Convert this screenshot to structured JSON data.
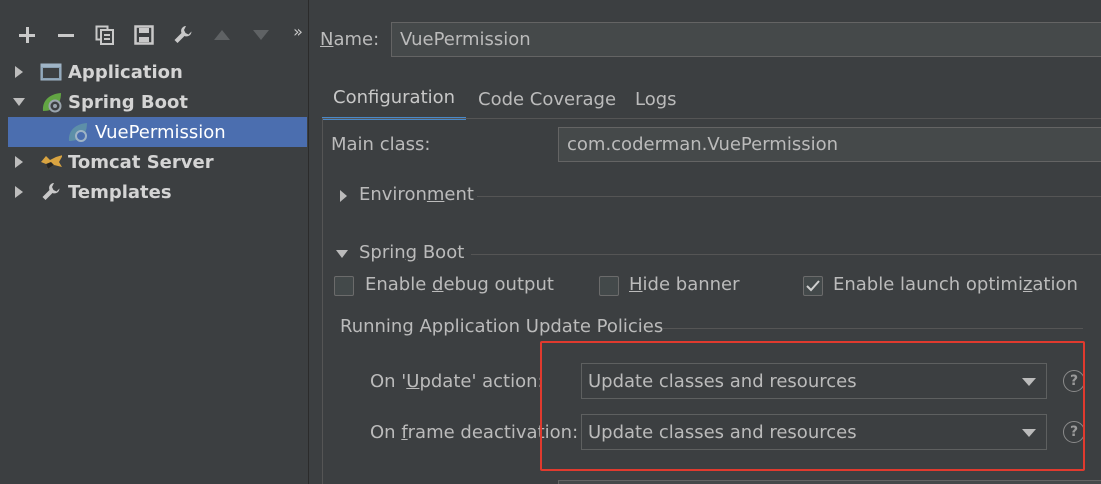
{
  "toolbar": {
    "items": [
      {
        "icon": "add-icon"
      },
      {
        "icon": "remove-icon"
      },
      {
        "icon": "copy-icon"
      },
      {
        "icon": "save-icon"
      },
      {
        "icon": "wrench-icon"
      },
      {
        "icon": "move-up-icon"
      },
      {
        "icon": "move-down-icon"
      },
      {
        "icon": "more-chevron-icon",
        "glyph": "»"
      }
    ]
  },
  "tree": {
    "items": [
      {
        "label": "Application",
        "expanded": false,
        "icon": "application-window-icon"
      },
      {
        "label": "Spring Boot",
        "expanded": true,
        "icon": "spring-boot-icon"
      },
      {
        "label": "VuePermission",
        "selected": true,
        "icon": "spring-boot-config-icon"
      },
      {
        "label": "Tomcat Server",
        "expanded": false,
        "icon": "tomcat-icon"
      },
      {
        "label": "Templates",
        "expanded": false,
        "icon": "wrench-icon"
      }
    ]
  },
  "name": {
    "label_prefix": "",
    "label_u": "N",
    "label_rest": "ame:",
    "value": "VuePermission"
  },
  "tabs": [
    {
      "label": "Configuration",
      "active": true
    },
    {
      "label": "Code Coverage",
      "active": false
    },
    {
      "label": "Logs",
      "active": false
    }
  ],
  "main_class": {
    "label": "Main class:",
    "value": "com.coderman.VuePermission"
  },
  "environment": {
    "pre": "Environ",
    "u": "m",
    "post": "ent",
    "expanded": false
  },
  "spring_boot_section": {
    "pre": "Sprin",
    "u": "g",
    "post": " Boot",
    "expanded": true
  },
  "checkboxes": [
    {
      "pre": "Enable ",
      "u": "d",
      "post": "ebug output",
      "checked": false
    },
    {
      "pre": "",
      "u": "H",
      "post": "ide banner",
      "checked": false
    },
    {
      "pre": "Enable launch optimi",
      "u": "z",
      "post": "ation",
      "checked": true
    }
  ],
  "update_policies": {
    "title": "Running Application Update Policies",
    "on_update": {
      "pre": "On '",
      "u": "U",
      "post": "pdate' action:",
      "value": "Update classes and resources"
    },
    "on_frame": {
      "pre": "On ",
      "u": "f",
      "post": "rame deactivation:",
      "value": "Update classes and resources"
    },
    "help_glyph": "?"
  },
  "colors": {
    "highlight": "#e03a2e",
    "selection": "#4b6eaf",
    "tab_underline": "#4a88c7"
  }
}
